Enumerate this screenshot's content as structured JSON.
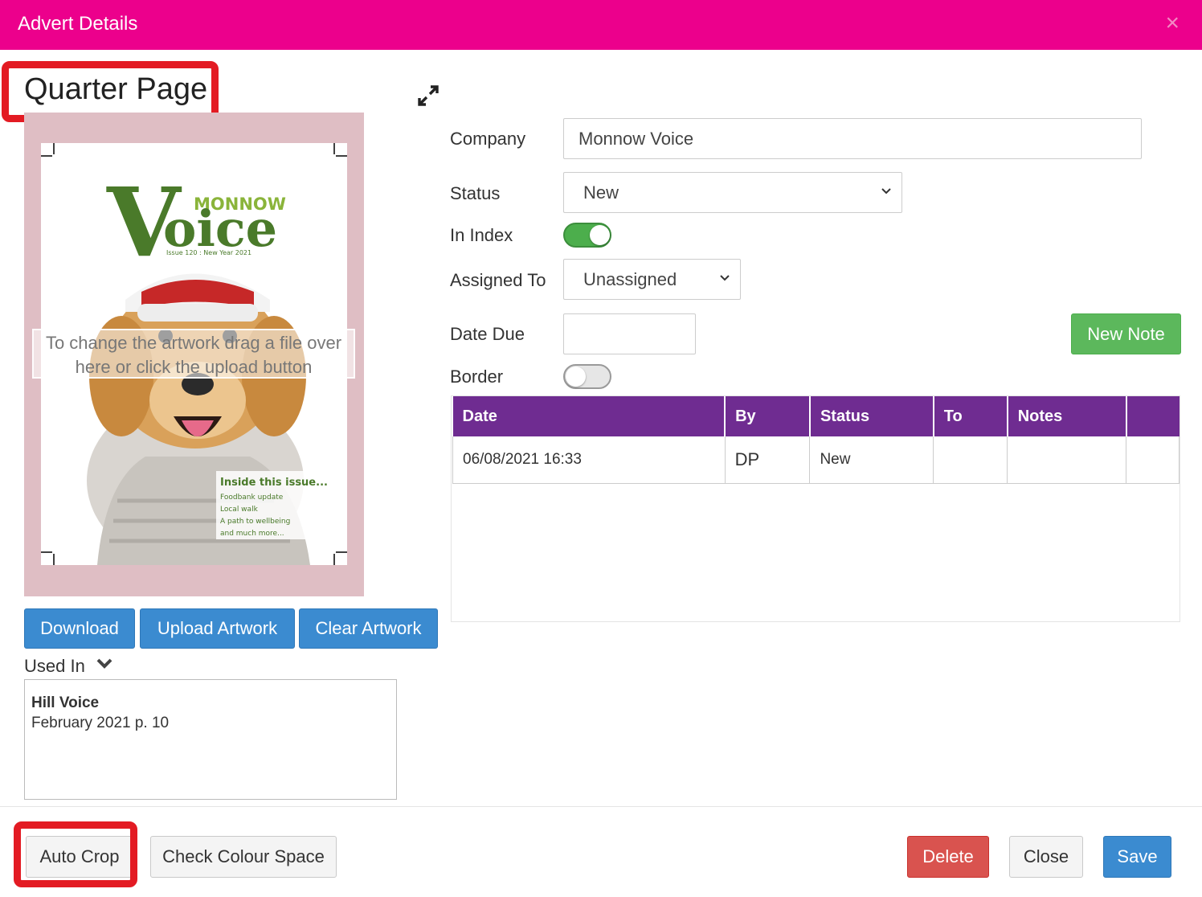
{
  "dialog": {
    "title": "Advert Details",
    "close_glyph": "×"
  },
  "advert": {
    "size_heading": "Quarter Page"
  },
  "artwork": {
    "drop_hint_line1": "To change the artwork drag a file over",
    "drop_hint_line2": "here or click the upload button",
    "cover": {
      "masthead_small": "MONNOW",
      "masthead_big": "Voice",
      "issue": "Issue 120 : New Year 2021",
      "inside_title": "Inside this issue...",
      "inside_items": [
        "Foodbank update",
        "Local walk",
        "A path to wellbeing",
        "and much more..."
      ]
    }
  },
  "artwork_buttons": {
    "download": "Download",
    "upload": "Upload Artwork",
    "clear": "Clear Artwork"
  },
  "used_in": {
    "label": "Used In",
    "entries": [
      {
        "publication": "Hill Voice",
        "issue": "February 2021 p. 10"
      }
    ]
  },
  "form": {
    "company_label": "Company",
    "company_value": "Monnow Voice",
    "status_label": "Status",
    "status_value": "New",
    "in_index_label": "In Index",
    "in_index_on": true,
    "assigned_label": "Assigned To",
    "assigned_value": "Unassigned",
    "date_due_label": "Date Due",
    "date_due_value": "",
    "border_label": "Border",
    "border_on": false,
    "new_note_button": "New Note"
  },
  "notes_table": {
    "headers": [
      "Date",
      "By",
      "Status",
      "To",
      "Notes",
      ""
    ],
    "rows": [
      [
        "06/08/2021 16:33",
        "DP",
        "New",
        "",
        "",
        ""
      ]
    ]
  },
  "footer": {
    "auto_crop": "Auto Crop",
    "check_colour": "Check Colour Space",
    "delete": "Delete",
    "close": "Close",
    "save": "Save"
  },
  "colors": {
    "titlebar": "#ec008c",
    "table_header": "#6f2c91",
    "primary": "#3b8bd0",
    "success": "#5cb85c",
    "danger": "#d9534f",
    "highlight_box": "#e31b23"
  }
}
